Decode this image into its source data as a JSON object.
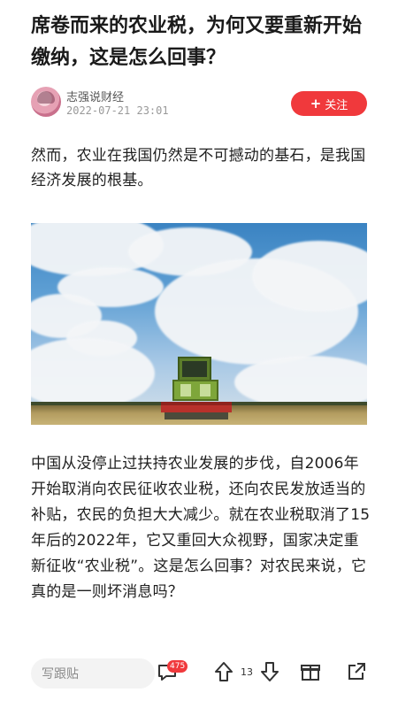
{
  "article": {
    "title": "席卷而来的农业税，为何又要重新开始缴纳，这是怎么回事？",
    "author": "志强说财经",
    "timestamp": "2022-07-21 23:01",
    "follow_label": "关注",
    "follow_prefix": "+",
    "paragraph_1": "然而，农业在我国仍然是不可撼动的基石，是我国经济发展的根基。",
    "paragraph_2": "中国从没停止过扶持农业发展的步伐，自2006年开始取消向农民征收农业税，还向农民发放适当的补贴，农民的负担大大减少。就在农业税取消了15年后的2022年，它又重回大众视野，国家决定重新征收“农业税”。这是怎么回事？对农民来说，它真的是一则坏消息吗？",
    "image_alt": "harvester-in-field-photo"
  },
  "bottom_bar": {
    "comment_placeholder": "写跟贴",
    "comment_count": "475",
    "vote_count": "13",
    "icons": [
      "comment-icon",
      "upvote-icon",
      "downvote-icon",
      "gift-icon",
      "share-icon"
    ]
  },
  "colors": {
    "accent": "#f0393c",
    "text": "#1f1f1f",
    "muted": "#999999"
  }
}
